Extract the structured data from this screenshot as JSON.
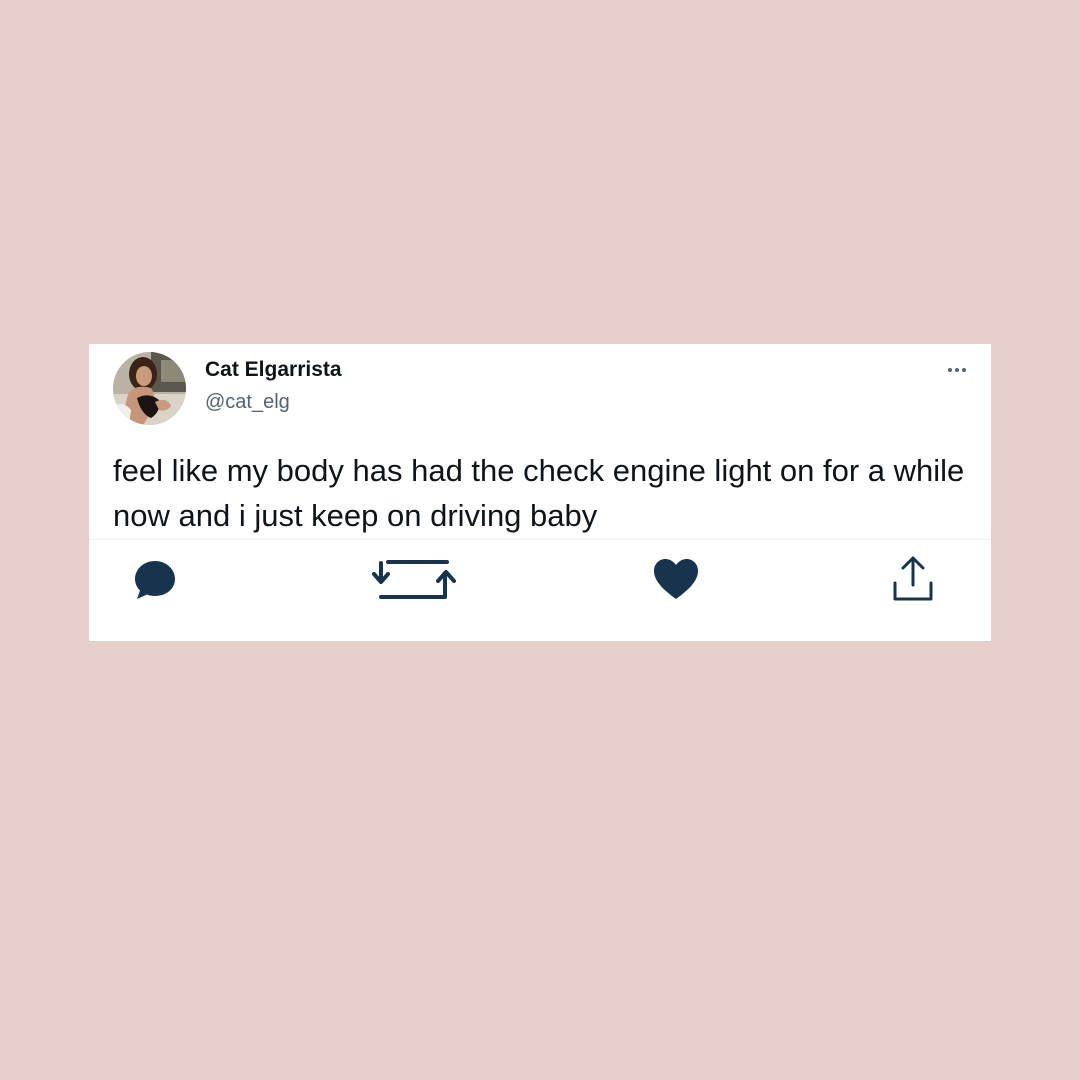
{
  "colors": {
    "background": "#e8cfcc",
    "card": "#ffffff",
    "name_text": "#0f1419",
    "handle_text": "#536471",
    "icon": "#17344f"
  },
  "tweet": {
    "display_name": "Cat Elgarrista",
    "handle": "@cat_elg",
    "text": "feel like my body has had the check engine light on for a while now and i just keep on driving baby"
  },
  "icons": {
    "more": "more-dots-icon",
    "reply": "reply-bubble-icon",
    "retweet": "retweet-arrows-icon",
    "like": "heart-icon",
    "share": "share-upload-icon"
  }
}
